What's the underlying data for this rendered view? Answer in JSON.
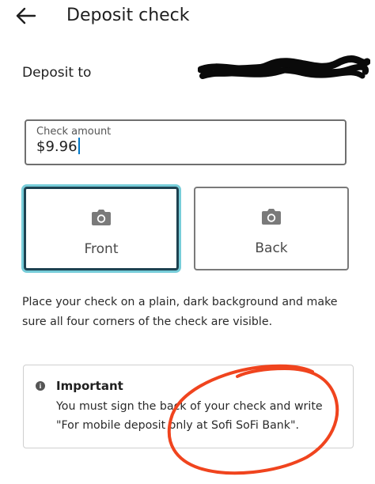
{
  "header": {
    "back_icon": "back-arrow-icon",
    "title": "Deposit check"
  },
  "deposit": {
    "label": "Deposit to"
  },
  "amount": {
    "label": "Check amount",
    "value": "$9.96"
  },
  "photos": {
    "front_label": "Front",
    "back_label": "Back",
    "icon": "camera-icon"
  },
  "instructions": "Place your check on a plain, dark background and make sure all four corners of the check are visible.",
  "important": {
    "icon": "info-icon",
    "icon_glyph": "i",
    "title": "Important",
    "body": "You must sign the back of your check and write \"For mobile deposit only at Sofi SoFi Bank\"."
  },
  "colors": {
    "selected_border": "#1d4251",
    "selected_glow": "#77cdd9",
    "annotation": "#f0441e",
    "caret": "#0078c8"
  }
}
